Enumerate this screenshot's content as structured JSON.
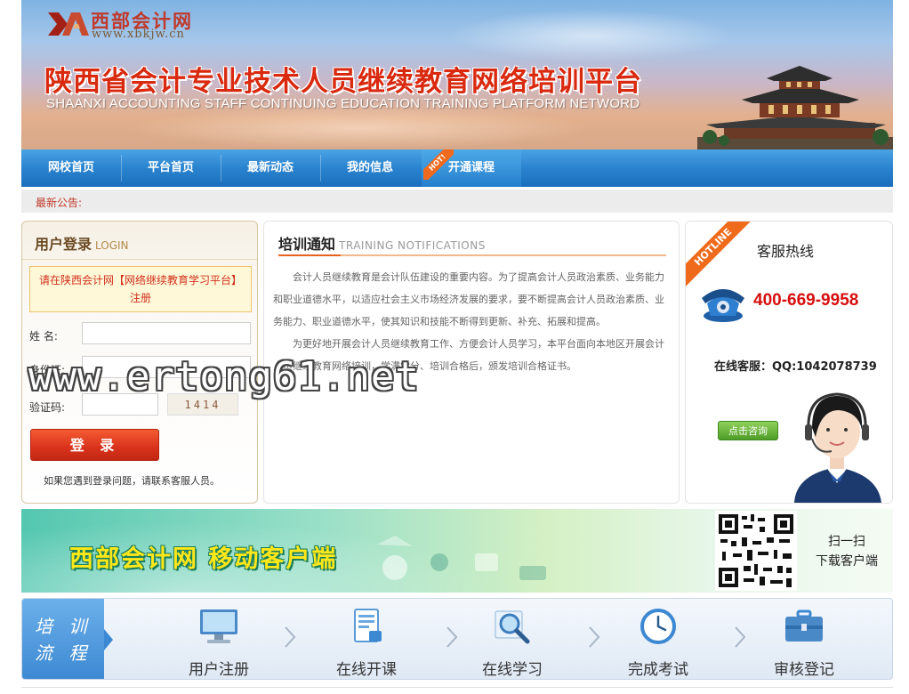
{
  "header": {
    "logo_cn": "西部会计网",
    "logo_url": "www.xbkjw.cn",
    "title": "陕西省会计专业技术人员继续教育网络培训平台",
    "subtitle": "SHAANXI ACCOUNTING STAFF CONTINUING EDUCATION TRAINING PLATFORM NETWORD"
  },
  "nav": {
    "items": [
      {
        "label": "网校首页"
      },
      {
        "label": "平台首页"
      },
      {
        "label": "最新动态"
      },
      {
        "label": "我的信息"
      },
      {
        "label": "开通课程",
        "badge": "HOT!"
      }
    ]
  },
  "notice": {
    "label": "最新公告:"
  },
  "login": {
    "title": "用户登录",
    "title_en": "LOGIN",
    "tip_line1": "请在陕西会计网【网络继续教育学习平台】",
    "tip_line2": "注册",
    "name_label": "姓    名:",
    "id_label": "身份证:",
    "captcha_label": "验证码:",
    "captcha_value": "1414",
    "submit_label": "登 录",
    "help": "如果您遇到登录问题，请联系客服人员。"
  },
  "training": {
    "title": "培训通知",
    "title_en": "TRAINING NOTIFICATIONS",
    "para1": "会计人员继续教育是会计队伍建设的重要内容。为了提高会计人员政治素质、业务能力和职业道德水平，以适应社会主义市场经济发展的要求，要不断提高会计人员政治素质、业务能力、职业道德水平，使其知识和技能不断得到更新、补充、拓展和提高。",
    "para2": "为更好地开展会计人员继续教育工作、方便会计人员学习，本平台面向本地区开展会计人员继续教育网络培训，学满学分、培训合格后，颁发培训合格证书。"
  },
  "hotline": {
    "ribbon": "HOTLINE",
    "title": "客服热线",
    "number": "400-669-9958",
    "qq": "在线客服：QQ:1042078739",
    "consult_label": "点击咨询"
  },
  "mobile": {
    "title": "西部会计网  移动客户端",
    "scan_line1": "扫一扫",
    "scan_line2": "下载客户端"
  },
  "process": {
    "label_line1": "培 训",
    "label_line2": "流 程",
    "steps": [
      {
        "label": "用户注册",
        "icon": "monitor-icon"
      },
      {
        "label": "在线开课",
        "icon": "document-icon"
      },
      {
        "label": "在线学习",
        "icon": "magnifier-icon"
      },
      {
        "label": "完成考试",
        "icon": "clock-icon"
      },
      {
        "label": "审核登记",
        "icon": "briefcase-icon"
      }
    ]
  },
  "watermark": "www.ertong61.net",
  "colors": {
    "nav_blue": "#2a83cf",
    "accent_red": "#d9290e",
    "hot_orange": "#ef6a1b",
    "hotline_red": "#d70f0f"
  }
}
